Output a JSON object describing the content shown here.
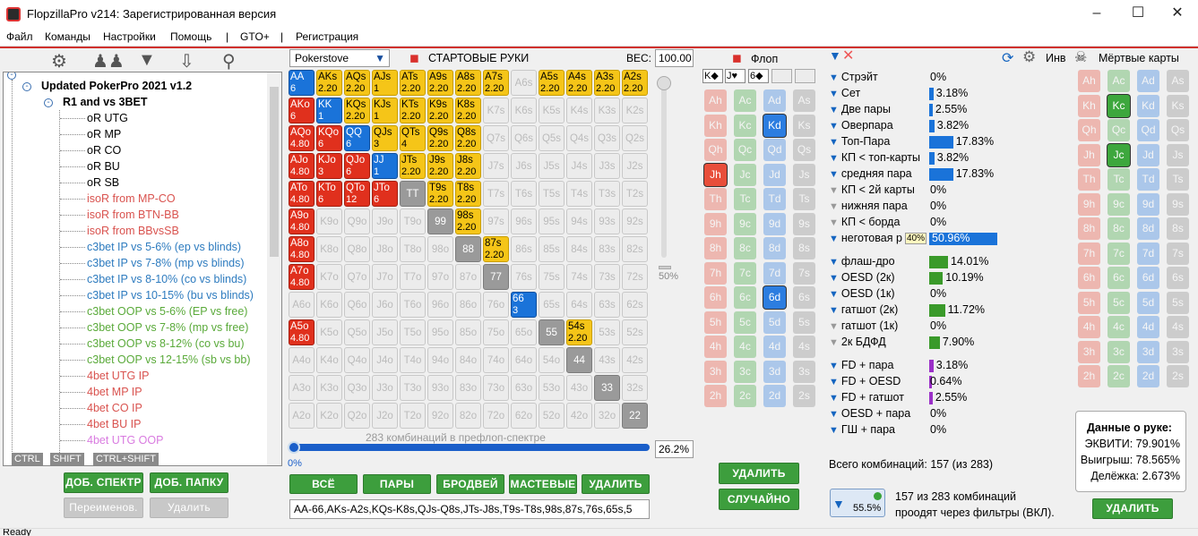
{
  "window": {
    "title": "FlopzillaPro v214: Зарегистрированная версия"
  },
  "menu": [
    "Файл",
    "Команды",
    "Настройки",
    "Помощь",
    "|",
    "GTO+",
    "|",
    "Регистрация"
  ],
  "tree": {
    "root": "Updated PokerPro 2021 v1.2",
    "folder": "R1 and vs 3BET",
    "items": [
      {
        "label": "oR UTG",
        "color": "#000000"
      },
      {
        "label": "oR MP",
        "color": "#000000"
      },
      {
        "label": "oR CO",
        "color": "#000000"
      },
      {
        "label": "oR BU",
        "color": "#000000"
      },
      {
        "label": "oR SB",
        "color": "#000000"
      },
      {
        "label": "isoR from MP-CO",
        "color": "#d9534f"
      },
      {
        "label": "isoR from BTN-BB",
        "color": "#d9534f"
      },
      {
        "label": "isoR from BBvsSB",
        "color": "#d9534f"
      },
      {
        "label": "c3bet IP vs 5-6% (ep vs blinds)",
        "color": "#2d7bbf"
      },
      {
        "label": "c3bet IP vs 7-8% (mp vs blinds)",
        "color": "#2d7bbf"
      },
      {
        "label": "c3bet IP vs 8-10% (co vs blinds)",
        "color": "#2d7bbf"
      },
      {
        "label": "c3bet IP vs 10-15% (bu vs blinds)",
        "color": "#2d7bbf"
      },
      {
        "label": "c3bet OOP vs 5-6% (EP vs free)",
        "color": "#5aaa3a"
      },
      {
        "label": "c3bet OOP vs 7-8% (mp vs free)",
        "color": "#5aaa3a"
      },
      {
        "label": "c3bet OOP vs 8-12% (co vs bu)",
        "color": "#5aaa3a"
      },
      {
        "label": "c3bet OOP vs 12-15% (sb vs bb)",
        "color": "#5aaa3a"
      },
      {
        "label": "4bet UTG IP",
        "color": "#d9534f"
      },
      {
        "label": "4bet MP IP",
        "color": "#d9534f"
      },
      {
        "label": "4bet CO IP",
        "color": "#d9534f"
      },
      {
        "label": "4bet BU IP",
        "color": "#d9534f"
      },
      {
        "label": "4bet UTG OOP",
        "color": "#d97be0"
      }
    ],
    "keys": [
      "CTRL",
      "SHIFT",
      "CTRL+SHIFT"
    ]
  },
  "tree_buttons": {
    "add_spectrum": "ДОБ. СПЕКТР",
    "add_folder": "ДОБ. ПАПКУ",
    "rename": "Переименов.",
    "delete": "Удалить"
  },
  "range": {
    "source": "Pokerstove",
    "title": "СТАРТОВЫЕ РУКИ",
    "weight_label": "ВЕС:",
    "weight": "100.00",
    "slider_label": "50%",
    "combos_text": "283 комбинаций в префлоп-спектре",
    "pct_low": "0%",
    "pct": "26.2%",
    "buttons": [
      "ВСЁ",
      "ПАРЫ",
      "БРОДВЕЙ",
      "МАСТЕВЫЕ",
      "УДАЛИТЬ"
    ],
    "text": "AA-66,AKs-A2s,KQs-K8s,QJs-Q8s,JTs-J8s,T9s-T8s,98s,87s,76s,65s,5",
    "ranks": [
      "A",
      "K",
      "Q",
      "J",
      "T",
      "9",
      "8",
      "7",
      "6",
      "5",
      "4",
      "3",
      "2"
    ],
    "highlight": {
      "AA": [
        "b",
        "6"
      ],
      "AKs": [
        "y",
        "2.20"
      ],
      "AQs": [
        "y",
        "2.20"
      ],
      "AJs": [
        "y",
        "1"
      ],
      "ATs": [
        "y",
        "2.20"
      ],
      "A9s": [
        "y",
        "2.20"
      ],
      "A8s": [
        "y",
        "2.20"
      ],
      "A7s": [
        "y",
        "2.20"
      ],
      "A5s": [
        "y",
        "2.20"
      ],
      "A4s": [
        "y",
        "2.20"
      ],
      "A3s": [
        "y",
        "2.20"
      ],
      "A2s": [
        "y",
        "2.20"
      ],
      "AKo": [
        "r",
        "6"
      ],
      "KK": [
        "b",
        "1"
      ],
      "KQs": [
        "y",
        "2.20"
      ],
      "KJs": [
        "y",
        "1"
      ],
      "KTs": [
        "y",
        "2.20"
      ],
      "K9s": [
        "y",
        "2.20"
      ],
      "K8s": [
        "y",
        "2.20"
      ],
      "AQo": [
        "r",
        "4.80"
      ],
      "KQo": [
        "r",
        "6"
      ],
      "QQ": [
        "b",
        "6"
      ],
      "QJs": [
        "y",
        "3"
      ],
      "QTs": [
        "y",
        "4"
      ],
      "Q9s": [
        "y",
        "2.20"
      ],
      "Q8s": [
        "y",
        "2.20"
      ],
      "AJo": [
        "r",
        "4.80"
      ],
      "KJo": [
        "r",
        "3"
      ],
      "QJo": [
        "r",
        "6"
      ],
      "JJ": [
        "b",
        "1"
      ],
      "JTs": [
        "y",
        "2.20"
      ],
      "J9s": [
        "y",
        "2.20"
      ],
      "J8s": [
        "y",
        "2.20"
      ],
      "ATo": [
        "r",
        "4.80"
      ],
      "KTo": [
        "r",
        "6"
      ],
      "QTo": [
        "r",
        "12"
      ],
      "JTo": [
        "r",
        "6"
      ],
      "TT": [
        "g",
        ""
      ],
      "T9s": [
        "y",
        "2.20"
      ],
      "T8s": [
        "y",
        "2.20"
      ],
      "A9o": [
        "r",
        "4.80"
      ],
      "99": [
        "g",
        ""
      ],
      "98s": [
        "y",
        "2.20"
      ],
      "A8o": [
        "r",
        "4.80"
      ],
      "88": [
        "g",
        ""
      ],
      "87s": [
        "y",
        "2.20"
      ],
      "A7o": [
        "r",
        "4.80"
      ],
      "77": [
        "g",
        ""
      ],
      "66": [
        "b",
        "3"
      ],
      "A5o": [
        "r",
        "4.80"
      ],
      "55": [
        "g",
        ""
      ],
      "54s": [
        "y",
        "2.20"
      ],
      "44": [
        "g",
        ""
      ],
      "33": [
        "g",
        ""
      ],
      "22": [
        "g",
        ""
      ]
    }
  },
  "flop": {
    "title": "Флоп",
    "cards": [
      "K◆",
      "J♥",
      "6◆"
    ],
    "delete": "УДАЛИТЬ",
    "random": "СЛУЧАЙНО"
  },
  "board_colors": {
    "h": "#e84e3a",
    "c": "#3da73d",
    "d": "#2c7de0",
    "s": "#8a8a8a"
  },
  "flop_selected": [
    "Kd",
    "Jh",
    "6d"
  ],
  "dead": {
    "title": "Мёртвые карты",
    "inv": "Инв",
    "selected": [
      "Kc",
      "Jc"
    ],
    "delete": "УДАЛИТЬ"
  },
  "filters": [
    {
      "label": "Стрэйт",
      "value": "0%",
      "pct": 0,
      "color": "#1a73d9"
    },
    {
      "label": "Сет",
      "value": "3.18%",
      "pct": 3.18,
      "color": "#1a73d9"
    },
    {
      "label": "Две пары",
      "value": "2.55%",
      "pct": 2.55,
      "color": "#1a73d9"
    },
    {
      "label": "Оверпара",
      "value": "3.82%",
      "pct": 3.82,
      "color": "#1a73d9"
    },
    {
      "label": "Топ-Пара",
      "value": "17.83%",
      "pct": 17.83,
      "color": "#1a73d9"
    },
    {
      "label": "КП < топ-карты",
      "value": "3.82%",
      "pct": 3.82,
      "color": "#1a73d9"
    },
    {
      "label": "средняя пара",
      "value": "17.83%",
      "pct": 17.83,
      "color": "#1a73d9"
    },
    {
      "label": "КП < 2й карты",
      "value": "0%",
      "pct": 0,
      "color": "#1a73d9",
      "grey": true
    },
    {
      "label": "нижняя пара",
      "value": "0%",
      "pct": 0,
      "color": "#1a73d9",
      "grey": true
    },
    {
      "label": "КП < борда",
      "value": "0%",
      "pct": 0,
      "color": "#1a73d9",
      "grey": true
    },
    {
      "label": "неготовая р",
      "value": "50.96%",
      "pct": 50.96,
      "color": "#1a73d9",
      "tip": "40%"
    },
    {
      "label": "флаш-дро",
      "value": "14.01%",
      "pct": 14.01,
      "color": "#3a9a2a"
    },
    {
      "label": "OESD (2к)",
      "value": "10.19%",
      "pct": 10.19,
      "color": "#3a9a2a"
    },
    {
      "label": "OESD (1к)",
      "value": "0%",
      "pct": 0,
      "color": "#3a9a2a"
    },
    {
      "label": "гатшот (2к)",
      "value": "11.72%",
      "pct": 11.72,
      "color": "#3a9a2a"
    },
    {
      "label": "гатшот (1к)",
      "value": "0%",
      "pct": 0,
      "color": "#3a9a2a",
      "grey": true
    },
    {
      "label": "2к БДФД",
      "value": "7.90%",
      "pct": 7.9,
      "color": "#3a9a2a",
      "grey": true
    },
    {
      "label": "FD + пара",
      "value": "3.18%",
      "pct": 3.18,
      "color": "#9b30c8"
    },
    {
      "label": "FD + OESD",
      "value": "0.64%",
      "pct": 0.64,
      "color": "#9b30c8"
    },
    {
      "label": "FD + гатшот",
      "value": "2.55%",
      "pct": 2.55,
      "color": "#9b30c8"
    },
    {
      "label": "OESD + пара",
      "value": "0%",
      "pct": 0,
      "color": "#9b30c8"
    },
    {
      "label": "ГШ + пара",
      "value": "0%",
      "pct": 0,
      "color": "#9b30c8"
    }
  ],
  "summary": {
    "total": "Всего комбинаций: 157 (из 283)",
    "filter_pct": "55.5%",
    "pass1": "157 из 283 комбинаций",
    "pass2": "проодят через фильтры (ВКЛ)."
  },
  "hand_data": {
    "title": "Данные о руке:",
    "equity": "ЭКВИТИ: 79.901%",
    "win": "Выигрыш: 78.565%",
    "tie": "Делёжка: 2.673%"
  },
  "status": "Ready"
}
